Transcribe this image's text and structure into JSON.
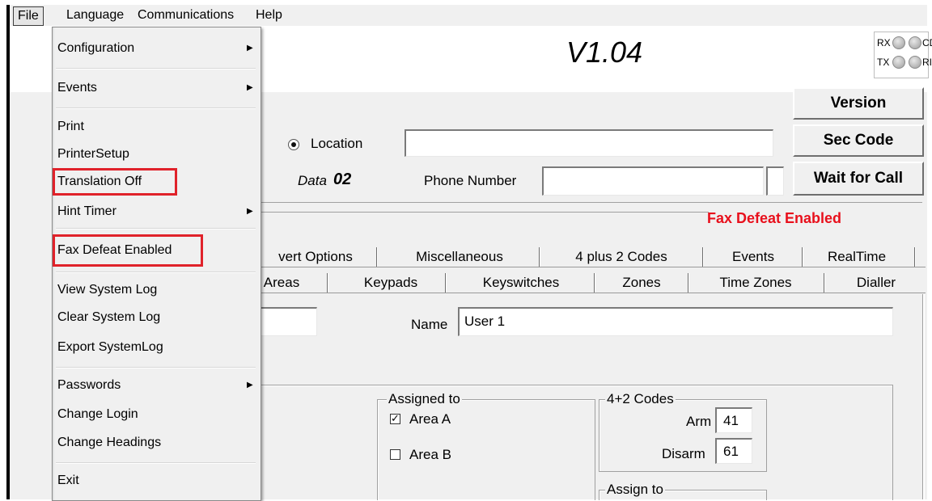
{
  "menubar": {
    "items": [
      "File",
      "Language",
      "Communications",
      "Help"
    ]
  },
  "file_menu": {
    "items": [
      "Configuration",
      "Events",
      "Print",
      "PrinterSetup",
      "Translation Off",
      "Hint Timer",
      "Fax Defeat Enabled",
      "View System Log",
      "Clear System Log",
      "Export SystemLog",
      "Passwords",
      "Change Login",
      "Change Headings",
      "Exit"
    ]
  },
  "header": {
    "version": "V1.04"
  },
  "leds": {
    "rx": "RX",
    "cd": "CD",
    "tx": "TX",
    "ri": "RI"
  },
  "buttons": {
    "version": "Version",
    "sec_code": "Sec Code",
    "wait_for_call": "Wait for Call"
  },
  "location": {
    "radio_label": "Location",
    "value": ""
  },
  "data_label": {
    "prefix": "Data",
    "number": "02"
  },
  "phone": {
    "label": "Phone Number",
    "value": ""
  },
  "status": {
    "text": "Fax Defeat Enabled",
    "color": "#e8101c"
  },
  "tabs": {
    "row1": [
      "vert Options",
      "Miscellaneous",
      "4 plus 2 Codes",
      "Events",
      "RealTime"
    ],
    "row2": [
      "Areas",
      "Keypads",
      "Keyswitches",
      "Zones",
      "Time Zones",
      "Dialler"
    ]
  },
  "user": {
    "name_label": "Name",
    "name_value": "User 1",
    "code_value": ""
  },
  "assigned": {
    "title": "Assigned to",
    "area_a": "Area A",
    "area_a_checked": true,
    "area_b": "Area B",
    "area_b_checked": false
  },
  "codes": {
    "title": "4+2 Codes",
    "arm_label": "Arm",
    "arm_value": "41",
    "disarm_label": "Disarm",
    "disarm_value": "61"
  },
  "assign_to": {
    "title": "Assign to"
  },
  "colors": {
    "highlight": "#e0222a"
  }
}
